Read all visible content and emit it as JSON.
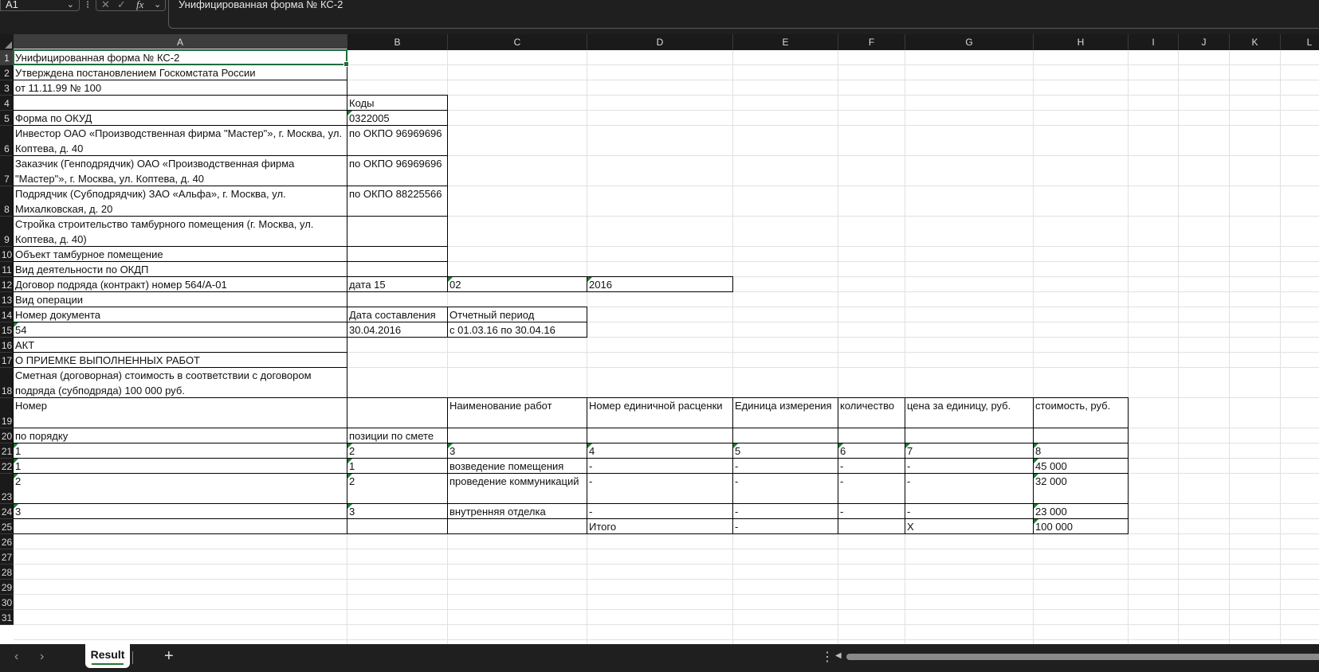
{
  "formula_bar": {
    "name_box": "A1",
    "cancel_icon": "✕",
    "confirm_icon": "✓",
    "fx_label": "fx",
    "formula_value": "Унифицированная форма № КС-2"
  },
  "columns": [
    "A",
    "B",
    "C",
    "D",
    "E",
    "F",
    "G",
    "H",
    "I",
    "J",
    "K",
    "L"
  ],
  "rows": [
    "1",
    "2",
    "3",
    "4",
    "5",
    "6",
    "7",
    "8",
    "9",
    "10",
    "11",
    "12",
    "13",
    "14",
    "15",
    "16",
    "17",
    "18",
    "19",
    "20",
    "21",
    "22",
    "23",
    "24",
    "25",
    "26",
    "27",
    "28",
    "29",
    "30",
    "31"
  ],
  "cells": {
    "A1": "Унифицированная форма № КС-2",
    "A2": "Утверждена постановлением Госкомстата России",
    "A3": "от 11.11.99 № 100",
    "B4": "Коды",
    "A5": "Форма по ОКУД",
    "B5": "0322005",
    "A6": "Инвестор ОАО «Производственная фирма \"Мастер\"», г. Москва, ул. Коптева, д. 40",
    "B6": "по ОКПО 96969696",
    "A7": "Заказчик (Генподрядчик) ОАО «Производственная фирма \"Мастер\"», г. Москва, ул. Коптева, д. 40",
    "B7": "по ОКПО 96969696",
    "A8": "Подрядчик (Субподрядчик) ЗАО «Альфа», г. Москва, ул. Михалковская, д. 20",
    "B8": "по ОКПО 88225566",
    "A9": "Стройка строительство тамбурного помещения (г. Москва, ул. Коптева, д. 40)",
    "A10": "Объект тамбурное помещение",
    "A11": "Вид деятельности по ОКДП",
    "A12": "Договор подряда (контракт) номер 564/А-01",
    "B12": "дата 15",
    "C12": "02",
    "D12": "2016",
    "A13": "Вид операции",
    "A14": "Номер документа",
    "B14": "Дата составления",
    "C14": "Отчетный период",
    "A15": "54",
    "B15": "30.04.2016",
    "C15": "с 01.03.16 по 30.04.16",
    "A16": "АКТ",
    "A17": "О ПРИЕМКЕ ВЫПОЛНЕННЫХ РАБОТ",
    "A18": "Сметная (договорная) стоимость в соответствии с договором подряда (субподряда) 100 000 руб.",
    "A19": "Номер",
    "C19": "Наименование работ",
    "D19": "Номер единичной расценки",
    "E19": "Единица измерения",
    "F19": "количество",
    "G19": "цена за единицу, руб.",
    "H19": "стоимость, руб.",
    "A20": "по порядку",
    "B20": "позиции по смете",
    "A21": "1",
    "B21": "2",
    "C21": "3",
    "D21": "4",
    "E21": "5",
    "F21": "6",
    "G21": "7",
    "H21": "8",
    "A22": "1",
    "B22": "1",
    "C22": "возведение помещения",
    "D22": "-",
    "E22": "-",
    "F22": "-",
    "G22": "-",
    "H22": "45 000",
    "A23": "2",
    "B23": "2",
    "C23": "проведение коммуникаций",
    "D23": "-",
    "E23": "-",
    "F23": "-",
    "G23": "-",
    "H23": "32 000",
    "A24": "3",
    "B24": "3",
    "C24": "внутренняя отделка",
    "D24": "-",
    "E24": "-",
    "F24": "-",
    "G24": "-",
    "H24": "23 000",
    "D25": "Итого",
    "E25": "-",
    "G25": "X",
    "H25": "100 000"
  },
  "sheet_tabs": [
    {
      "label": "Result"
    }
  ],
  "bottom": {
    "prev_icon": "‹",
    "next_icon": "›",
    "add_icon": "+",
    "more_icon": "⋮"
  }
}
